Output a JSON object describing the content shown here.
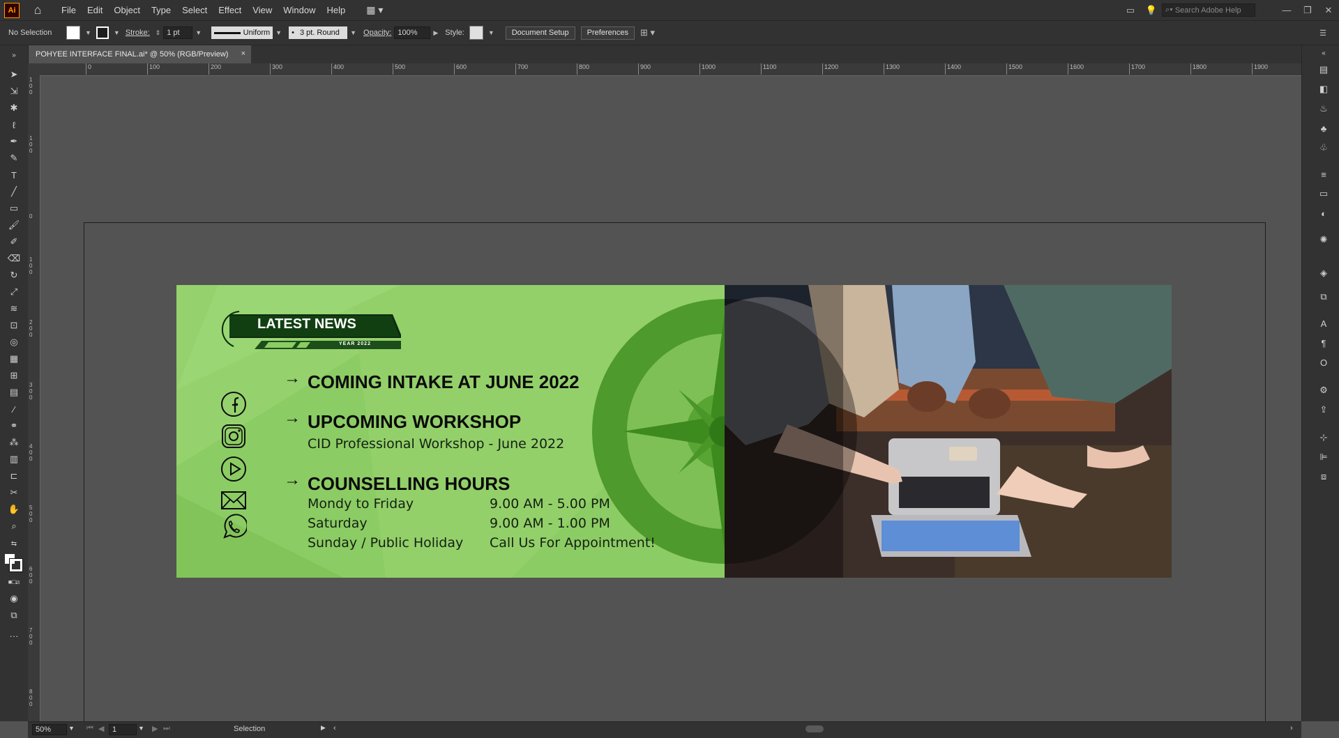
{
  "app": {
    "logo": "Ai",
    "home_icon": "home-icon",
    "workspace_icon": "workspace-switcher-icon"
  },
  "menu": [
    "File",
    "Edit",
    "Object",
    "Type",
    "Select",
    "Effect",
    "View",
    "Window",
    "Help"
  ],
  "search": {
    "placeholder": "Search Adobe Help"
  },
  "control": {
    "selection": "No Selection",
    "stroke_label": "Stroke:",
    "stroke_value": "1 pt",
    "profile": "Uniform",
    "brush": "3 pt. Round",
    "opacity_label": "Opacity:",
    "opacity_value": "100%",
    "style_label": "Style:",
    "doc_setup": "Document Setup",
    "preferences": "Preferences"
  },
  "tab": {
    "title": "POHYEE INTERFACE FINAL.ai* @ 50% (RGB/Preview)",
    "close": "×"
  },
  "ruler": {
    "h_ticks": [
      "0",
      "100",
      "200",
      "300",
      "400",
      "500",
      "600",
      "700",
      "800",
      "900",
      "1000",
      "1100",
      "1200",
      "1300",
      "1400",
      "1500",
      "1600",
      "1700",
      "1800",
      "1900"
    ]
  },
  "banner": {
    "badge_title": "LATEST NEWS",
    "badge_year": "YEAR 2022",
    "arrow": "→",
    "item1": "COMING INTAKE AT JUNE 2022",
    "item2": "UPCOMING WORKSHOP",
    "item2_sub": "CID Professional Workshop - June 2022",
    "item3": "COUNSELLING HOURS",
    "hours": [
      {
        "day": "Mondy to Friday",
        "time": "9.00 AM - 5.00 PM"
      },
      {
        "day": "Saturday",
        "time": "9.00 AM - 1.00 PM"
      },
      {
        "day": "Sunday / Public Holiday",
        "time": "Call Us For Appointment!"
      }
    ],
    "accent_green": "#8ccc64",
    "dark_green": "#1e5c14"
  },
  "status": {
    "zoom": "50%",
    "page": "1",
    "mode": "Selection"
  }
}
